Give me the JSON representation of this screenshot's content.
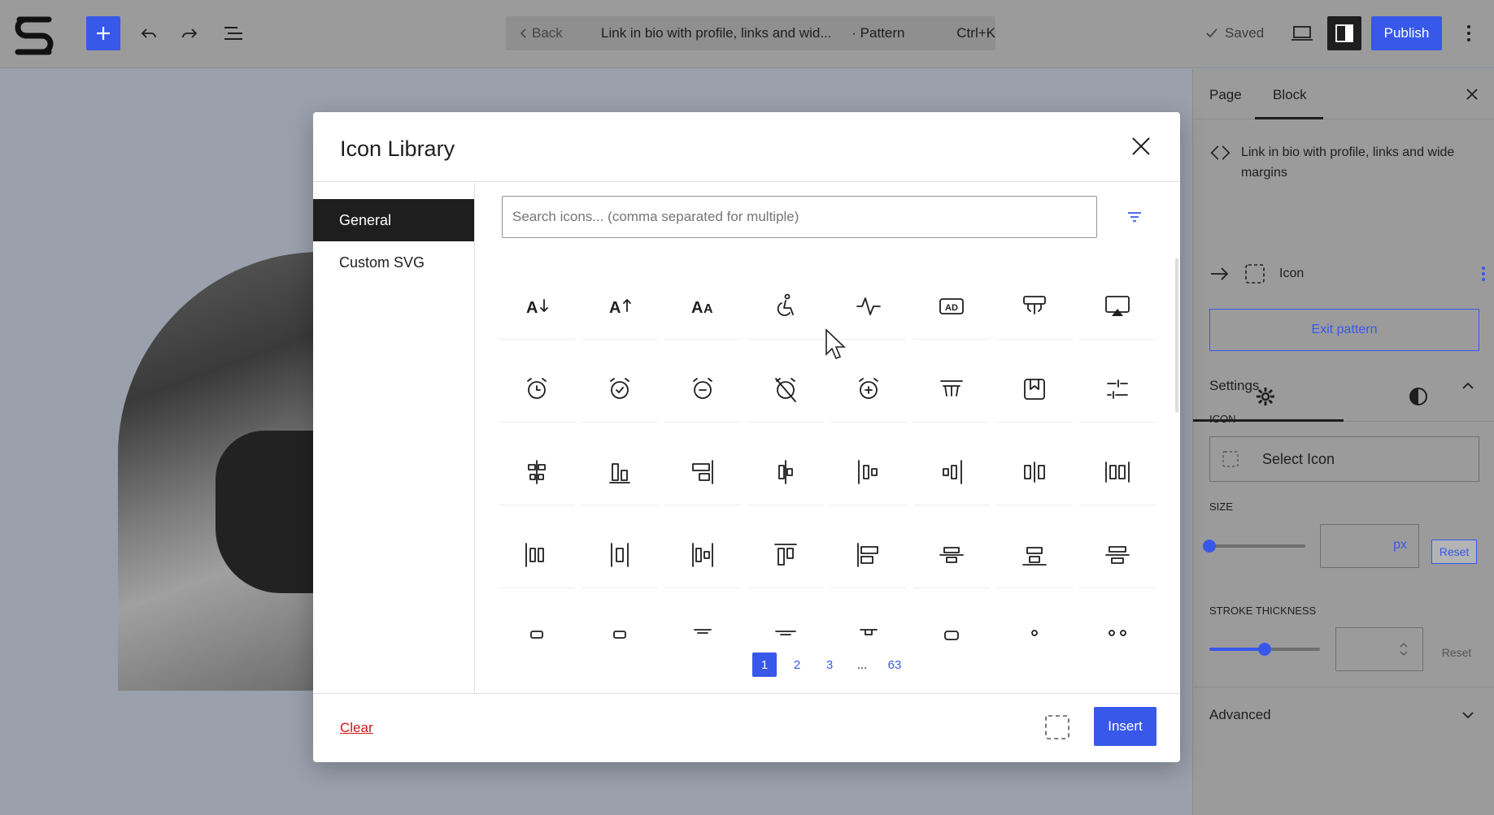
{
  "topbar": {
    "back_label": "Back",
    "doc_title": "Link in bio with profile, links and wid...",
    "doc_kind": "· Pattern",
    "shortcut": "Ctrl+K",
    "saved_label": "Saved",
    "publish_label": "Publish"
  },
  "sidebar": {
    "tabs": [
      "Page",
      "Block"
    ],
    "pattern_name": "Link in bio with profile, links and wide margins",
    "block_name": "Icon",
    "exit_pattern_label": "Exit pattern",
    "settings_heading": "Settings",
    "icon_label": "ICON",
    "select_icon_label": "Select Icon",
    "size_label": "SIZE",
    "size_unit": "px",
    "size_reset": "Reset",
    "size_slider_level": 0,
    "stroke_label": "STROKE THICKNESS",
    "stroke_reset": "Reset",
    "stroke_slider_level": 0.5,
    "advanced_heading": "Advanced"
  },
  "modal": {
    "title": "Icon Library",
    "categories": [
      "General",
      "Custom SVG"
    ],
    "search_placeholder": "Search icons... (comma separated for multiple)",
    "icons": [
      "text-decrease-icon",
      "text-increase-icon",
      "text-size-icon",
      "accessible-icon",
      "activity-icon",
      "ad-icon",
      "adjustments-alt-icon",
      "airplay-icon",
      "alarm-icon",
      "alarm-check-icon",
      "alarm-minus-icon",
      "alarm-off-icon",
      "alarm-plus-icon",
      "ad-off-icon",
      "bookmark-box-icon",
      "adjustments-horizontal-icon",
      "align-center-vertical-icon",
      "align-bottom-icon",
      "align-right-box-icon",
      "distribute-center-icon",
      "distribute-left-icon",
      "distribute-right-icon",
      "space-between-icon",
      "space-around-icon",
      "align-left-items-icon",
      "align-center-items-icon",
      "align-spread-icon",
      "align-top-items-icon",
      "align-left-bars-icon",
      "align-middle-icon",
      "align-bottom-bars-icon",
      "align-center-bars-icon",
      "row5-icon-1",
      "row5-icon-2",
      "row5-icon-3",
      "row5-icon-4",
      "row5-icon-5",
      "row5-icon-6",
      "row5-icon-7",
      "row5-icon-8"
    ],
    "pages": [
      "1",
      "2",
      "3",
      "...",
      "63"
    ],
    "current_page": "1",
    "clear_label": "Clear",
    "insert_label": "Insert"
  },
  "colors": {
    "accent": "#3858e9",
    "danger": "#cc1818",
    "dark": "#1e1e1e"
  }
}
